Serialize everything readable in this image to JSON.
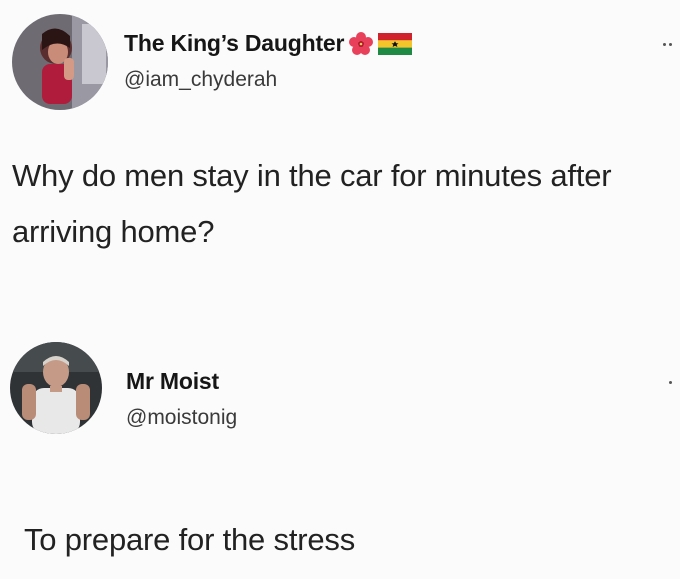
{
  "tweets": [
    {
      "display_name": "The King’s Daughter",
      "handle": "@iam_chyderah",
      "name_emojis": [
        "hibiscus-flower-icon",
        "ghana-flag-icon"
      ],
      "text": "Why do men stay in the car for minutes after arriving home?"
    },
    {
      "display_name": "Mr Moist",
      "handle": "@moistonig",
      "text": "To prepare for the stress"
    }
  ],
  "colors": {
    "background": "#fbfbfb",
    "text": "#222222",
    "handle": "#3a3a3a"
  }
}
